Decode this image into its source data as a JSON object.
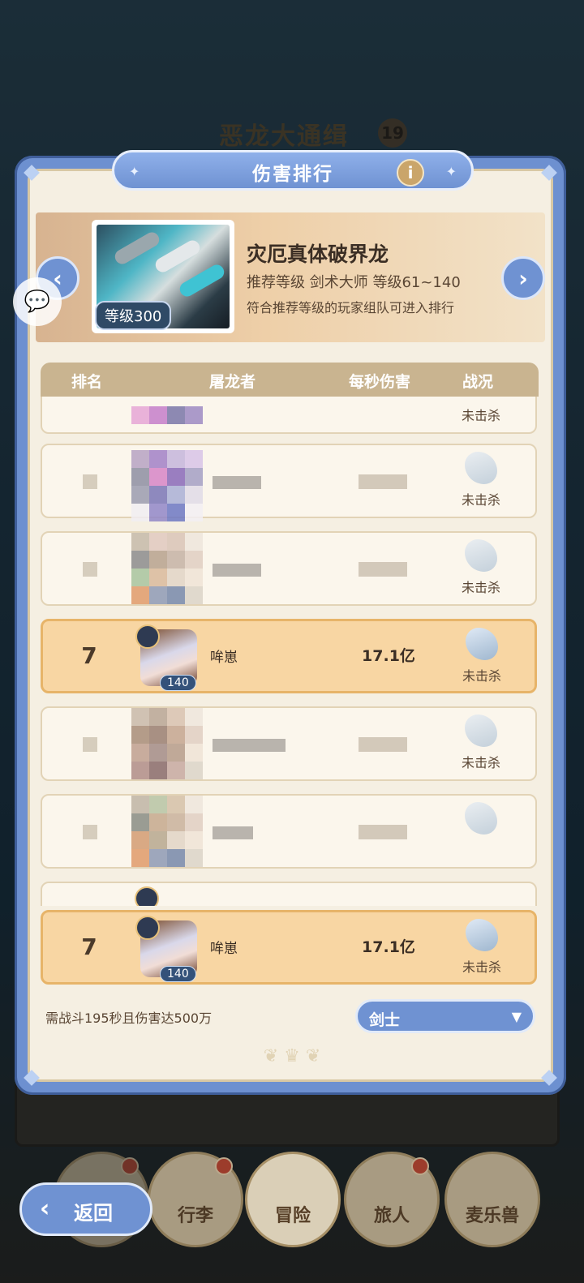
{
  "background": {
    "title": "恶龙大通缉",
    "title_badge": "19"
  },
  "modal": {
    "title": "伤害排行",
    "info_icon": "i",
    "boss": {
      "name": "灾厄真体破界龙",
      "level_label": "等级300",
      "recommend": "推荐等级  剑术大师  等级61~140",
      "note": "符合推荐等级的玩家组队可进入排行"
    },
    "table": {
      "headers": [
        "排名",
        "屠龙者",
        "每秒伤害",
        "战况"
      ],
      "rows": [
        {
          "rank": "",
          "name": "",
          "dps": "",
          "status": "未击杀",
          "blurred": true
        },
        {
          "rank": "",
          "name": "",
          "dps": "",
          "status": "未击杀",
          "blurred": true
        },
        {
          "rank": "",
          "name": "",
          "dps": "",
          "status": "未击杀",
          "blurred": true
        },
        {
          "rank": "7",
          "name": "哞崽",
          "dps": "17.1亿",
          "status": "未击杀",
          "avatar_level": "140",
          "mine": true
        },
        {
          "rank": "",
          "name": "",
          "dps": "",
          "status": "未击杀",
          "blurred": true
        },
        {
          "rank": "",
          "name": "",
          "dps": "",
          "status": "",
          "blurred": true
        }
      ]
    },
    "my_row": {
      "rank": "7",
      "name": "哞崽",
      "dps": "17.1亿",
      "status": "未击杀",
      "avatar_level": "140"
    },
    "requirement": "需战斗195秒且伤害达500万",
    "class_select": {
      "value": "剑士",
      "arrow": "▼"
    }
  },
  "nav": {
    "back": "返回",
    "items": [
      "行李",
      "冒险",
      "旅人",
      "麦乐兽"
    ]
  },
  "colors": {
    "accent": "#6f92d2",
    "panel": "#f5efe2",
    "highlight": "#f8d6a3"
  }
}
